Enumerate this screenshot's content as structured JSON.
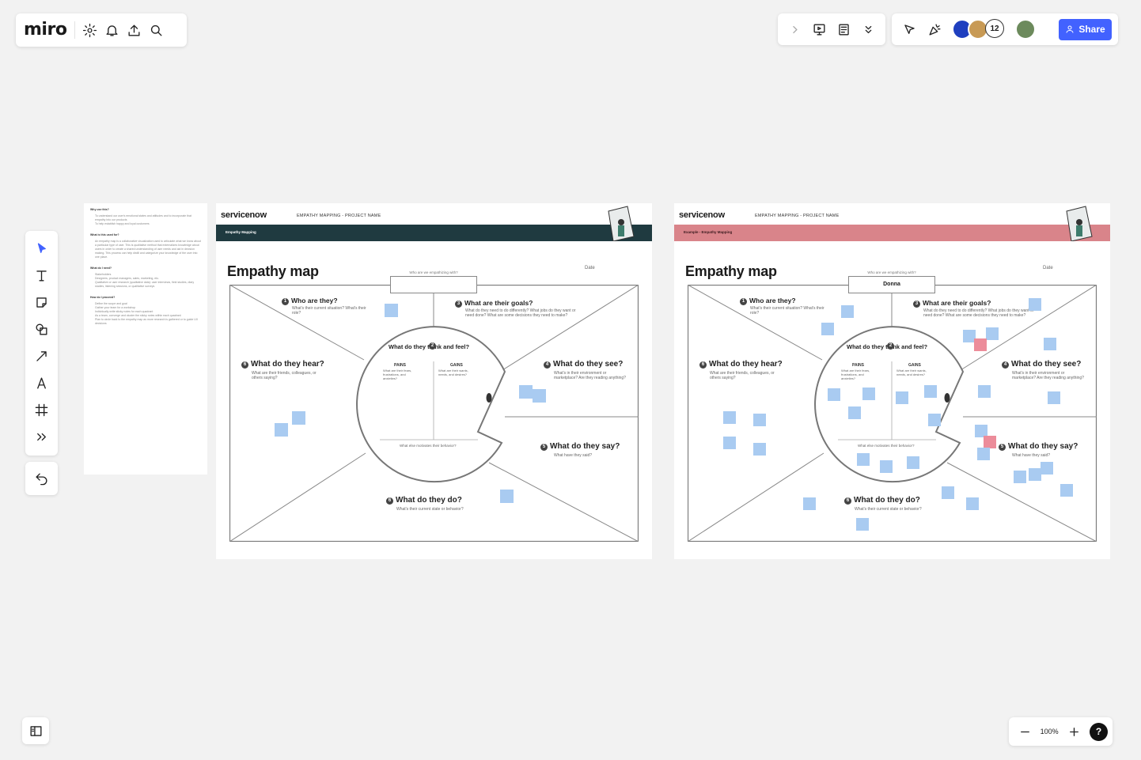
{
  "app": {
    "logo": "miro"
  },
  "top_right": {
    "share_label": "Share",
    "collaborator_count": "12"
  },
  "zoom": {
    "level": "100%",
    "help": "?"
  },
  "instructions": {
    "sections": [
      {
        "heading": "Why use this?",
        "items": [
          "To understand our user's emotional states and attitudes and to incorporate that empathy into our products",
          "To help establish happy and loyal customers"
        ]
      },
      {
        "heading": "What is this used for?",
        "items": [
          "An empathy map is a collaborative visualization used to articulate what we know about a particular type of user. This is qualitative method that externalizes knowledge about users in order to create a shared understanding of user needs and aid in decision making. This process can help distill and categorize your knowledge of the user into one place."
        ]
      },
      {
        "heading": "What do I need?",
        "items": [
          "Stakeholders",
          "Designers, product managers, sales, marketing, etc.",
          "Qualitative or user research (qualitative data): user interviews, field studies, diary studies, listening sessions, or qualitative surveys"
        ]
      },
      {
        "heading": "How do I proceed?",
        "items": [
          "Define the scope and goal",
          "Gather your team for a workshop",
          "Individually write sticky notes for each quadrant",
          "As a team, converge and cluster the sticky notes within each quadrant",
          "Plan to circle back to the empathy map as more research is gathered or to guide UX decisions"
        ]
      }
    ]
  },
  "frames": [
    {
      "brand": "servicenow",
      "project": "EMPATHY MAPPING - PROJECT NAME",
      "band_label": "Empathy Mapping",
      "title": "Empathy map",
      "date_label": "Date",
      "who_label": "Who are we empathizing with?",
      "who_value": "",
      "q1": "Who are they?",
      "q1_sub": "What's their current situation? What's their role?",
      "q2": "What are their goals?",
      "q2_sub": "What do they need to do differently? What jobs do they want or need done? What are some decisions they need to make?",
      "q3": "What do they hear?",
      "q3_sub": "What are their friends, colleagues, or others saying?",
      "q4": "What do they see?",
      "q4_sub": "What's in their environment or marketplace? Are they reading anything?",
      "q5": "What do they say?",
      "q5_sub": "What have they said?",
      "q6": "What do they do?",
      "q6_sub": "What's their current state or behavior?",
      "q7": "What do they think and feel?",
      "pains": "PAINS",
      "pains_sub": "What are their fears, frustrations, and anxieties?",
      "gains": "GAINS",
      "gains_sub": "What are their wants, needs, and desires?",
      "motivates": "What else motivates their behavior?",
      "colors": {
        "band": "#1f3a40"
      }
    },
    {
      "brand": "servicenow",
      "project": "EMPATHY MAPPING - PROJECT NAME",
      "band_label": "Example - Empathy Mapping",
      "title": "Empathy map",
      "date_label": "Date",
      "who_label": "Who are we empathizing with?",
      "who_value": "Donna",
      "q1": "Who are they?",
      "q1_sub": "What's their current situation? What's their role?",
      "q2": "What are their goals?",
      "q2_sub": "What do they need to do differently? What jobs do they want or need done? What are some decisions they need to make?",
      "q3": "What do they hear?",
      "q3_sub": "What are their friends, colleagues, or others saying?",
      "q4": "What do they see?",
      "q4_sub": "What's in their environment or marketplace? Are they reading anything?",
      "q5": "What do they say?",
      "q5_sub": "What have they said?",
      "q6": "What do they do?",
      "q6_sub": "What's their current state or behavior?",
      "q7": "What do they think and feel?",
      "pains": "PAINS",
      "pains_sub": "What are their fears, frustrations, and anxieties?",
      "gains": "GAINS",
      "gains_sub": "What are their wants, needs, and desires?",
      "motivates": "What else motivates their behavior?",
      "colors": {
        "band": "#d9848a"
      }
    }
  ],
  "colors": {
    "accent": "#4262ff",
    "sticky": "#a9cbf1",
    "sticky_pink": "#ec8c9a"
  }
}
